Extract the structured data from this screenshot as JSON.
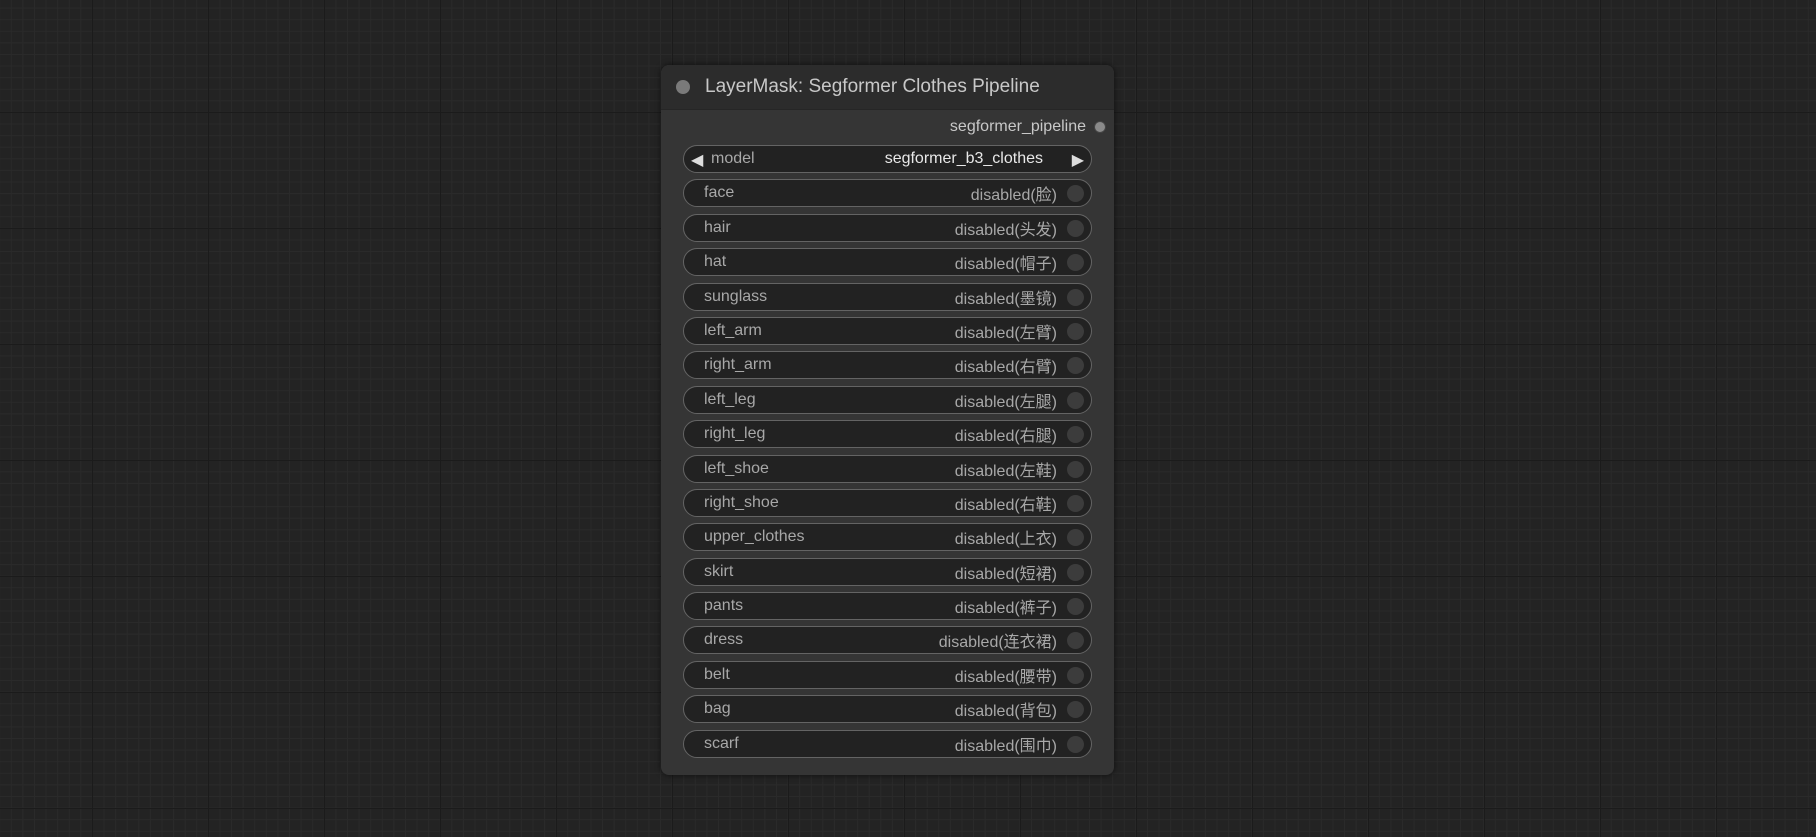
{
  "node": {
    "title": "LayerMask: Segformer Clothes Pipeline",
    "output_label": "segformer_pipeline"
  },
  "model": {
    "label": "model",
    "value": "segformer_b3_clothes"
  },
  "toggles": [
    {
      "label": "face",
      "value": "disabled(脸)"
    },
    {
      "label": "hair",
      "value": "disabled(头发)"
    },
    {
      "label": "hat",
      "value": "disabled(帽子)"
    },
    {
      "label": "sunglass",
      "value": "disabled(墨镜)"
    },
    {
      "label": "left_arm",
      "value": "disabled(左臂)"
    },
    {
      "label": "right_arm",
      "value": "disabled(右臂)"
    },
    {
      "label": "left_leg",
      "value": "disabled(左腿)"
    },
    {
      "label": "right_leg",
      "value": "disabled(右腿)"
    },
    {
      "label": "left_shoe",
      "value": "disabled(左鞋)"
    },
    {
      "label": "right_shoe",
      "value": "disabled(右鞋)"
    },
    {
      "label": "upper_clothes",
      "value": "disabled(上衣)"
    },
    {
      "label": "skirt",
      "value": "disabled(短裙)"
    },
    {
      "label": "pants",
      "value": "disabled(裤子)"
    },
    {
      "label": "dress",
      "value": "disabled(连衣裙)"
    },
    {
      "label": "belt",
      "value": "disabled(腰带)"
    },
    {
      "label": "bag",
      "value": "disabled(背包)"
    },
    {
      "label": "scarf",
      "value": "disabled(围巾)"
    }
  ]
}
